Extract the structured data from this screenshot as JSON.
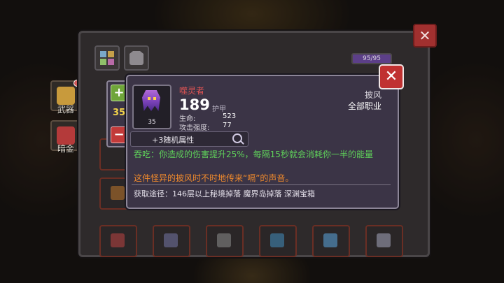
{
  "background": {
    "accent": "#c89a3c"
  },
  "panel": {
    "close_symbol": "✕",
    "tabs": [
      {
        "icon": "grid-icon"
      },
      {
        "icon": "helmet-icon"
      }
    ],
    "capacity": {
      "text": "95/95",
      "fraction": 1.0
    }
  },
  "side_labels": [
    {
      "icon": "weapon-icon",
      "label": "武器"
    },
    {
      "icon": "gold-icon",
      "label": "暗金"
    }
  ],
  "tooltip": {
    "close_symbol": "✕",
    "item": {
      "icon": "cloak-icon",
      "level": "35",
      "name": "噬灵者",
      "armor_value": "189",
      "armor_label": "护甲",
      "stats": [
        {
          "label": "生命:",
          "value": "523"
        },
        {
          "label": "攻击强度:",
          "value": "77"
        }
      ],
      "type": "披风",
      "class": "全部职业"
    },
    "level_control": {
      "plus": "+",
      "minus": "−",
      "value": "35"
    },
    "random_attr": "+3随机属性",
    "effect": "吞吃：你造成的伤害提升25%，每隔15秒就会消耗你一半的能量",
    "lore": "这件怪异的披风时不时地传来“嗝”的声音。",
    "source": "获取途径：146层以上秘境掉落 魔界岛掉落 深渊宝箱"
  },
  "colors": {
    "name_red": "#e05454",
    "effect_green": "#5fd15a",
    "lore_orange": "#f08a2c",
    "level_yellow": "#f2d24a"
  }
}
